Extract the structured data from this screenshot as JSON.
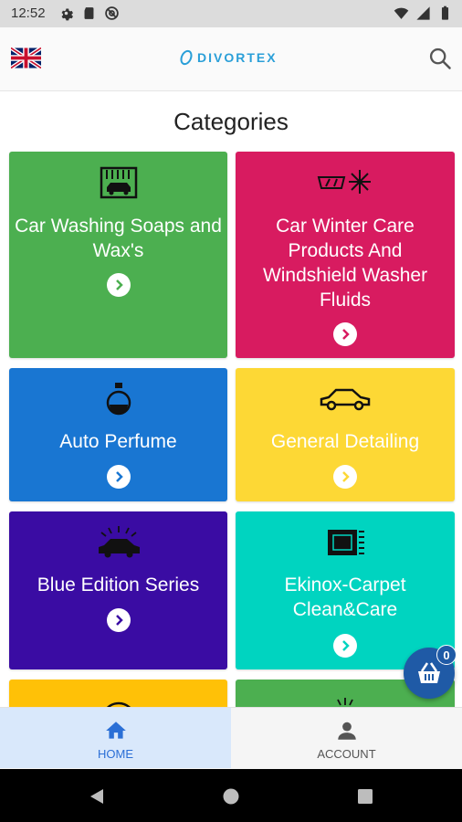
{
  "status_bar": {
    "time": "12:52",
    "left_icons": [
      "gear-icon",
      "sd-card-icon",
      "at-sign-icon"
    ],
    "right_icons": [
      "wifi-icon",
      "signal-icon",
      "battery-icon"
    ]
  },
  "app_bar": {
    "logo_text": "DIVORTEX",
    "flag": "uk-flag-icon",
    "search_icon": "search-icon"
  },
  "page": {
    "title": "Categories"
  },
  "categories": [
    {
      "title": "Car Washing Soaps and Wax's",
      "color": "#4caf50",
      "icon": "car-wash-icon"
    },
    {
      "title": "Car Winter Care Products And Windshield Washer Fluids",
      "color": "#d81b60",
      "icon": "windshield-snowflake-icon"
    },
    {
      "title": "Auto Perfume",
      "color": "#1976d2",
      "icon": "perfume-bottle-icon"
    },
    {
      "title": "General Detailing",
      "color": "#fdd835",
      "icon": "car-outline-icon"
    },
    {
      "title": "Blue Edition Series",
      "color": "#3a0ca3",
      "icon": "car-shine-icon"
    },
    {
      "title": "Ekinox-Carpet Clean&Care",
      "color": "#00d4c0",
      "icon": "carpet-icon"
    },
    {
      "title": "",
      "color": "#ffc107",
      "icon": "partial-tile"
    },
    {
      "title": "",
      "color": "#4caf50",
      "icon": "partial-tile"
    }
  ],
  "cart": {
    "count": "0",
    "icon": "basket-icon"
  },
  "bottom_nav": {
    "home_label": "HOME",
    "account_label": "ACCOUNT"
  },
  "colors": {
    "brand": "#2a9fd8",
    "fab": "#1f5aa6",
    "nav_active": "#2b6fd6"
  }
}
